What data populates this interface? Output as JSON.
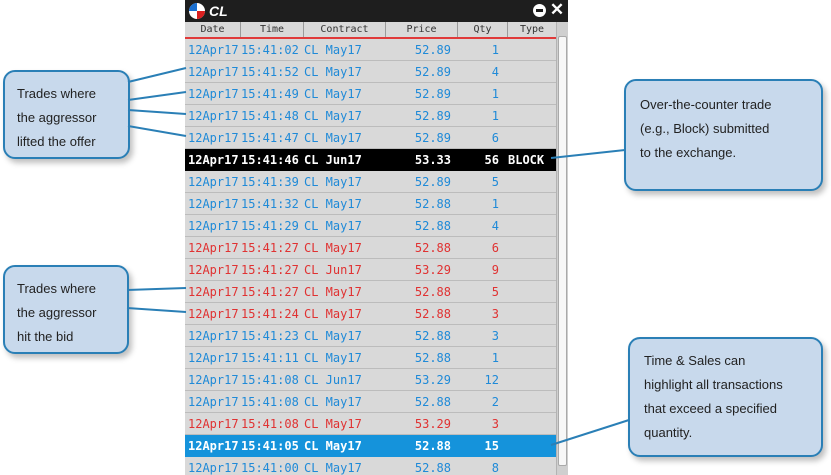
{
  "window": {
    "title": "CL",
    "columns": [
      "Date",
      "Time",
      "Contract",
      "Price",
      "Qty",
      "Type"
    ]
  },
  "trades": [
    {
      "date": "12Apr17",
      "time": "15:41:02",
      "contract": "CL May17",
      "price": "52.89",
      "qty": "1",
      "type": "",
      "side": "buy"
    },
    {
      "date": "12Apr17",
      "time": "15:41:52",
      "contract": "CL May17",
      "price": "52.89",
      "qty": "4",
      "type": "",
      "side": "buy"
    },
    {
      "date": "12Apr17",
      "time": "15:41:49",
      "contract": "CL May17",
      "price": "52.89",
      "qty": "1",
      "type": "",
      "side": "buy"
    },
    {
      "date": "12Apr17",
      "time": "15:41:48",
      "contract": "CL May17",
      "price": "52.89",
      "qty": "1",
      "type": "",
      "side": "buy"
    },
    {
      "date": "12Apr17",
      "time": "15:41:47",
      "contract": "CL May17",
      "price": "52.89",
      "qty": "6",
      "type": "",
      "side": "buy"
    },
    {
      "date": "12Apr17",
      "time": "15:41:46",
      "contract": "CL Jun17",
      "price": "53.33",
      "qty": "56",
      "type": "BLOCK",
      "side": "block"
    },
    {
      "date": "12Apr17",
      "time": "15:41:39",
      "contract": "CL May17",
      "price": "52.89",
      "qty": "5",
      "type": "",
      "side": "buy"
    },
    {
      "date": "12Apr17",
      "time": "15:41:32",
      "contract": "CL May17",
      "price": "52.88",
      "qty": "1",
      "type": "",
      "side": "buy"
    },
    {
      "date": "12Apr17",
      "time": "15:41:29",
      "contract": "CL May17",
      "price": "52.88",
      "qty": "4",
      "type": "",
      "side": "buy"
    },
    {
      "date": "12Apr17",
      "time": "15:41:27",
      "contract": "CL May17",
      "price": "52.88",
      "qty": "6",
      "type": "",
      "side": "sell"
    },
    {
      "date": "12Apr17",
      "time": "15:41:27",
      "contract": "CL Jun17",
      "price": "53.29",
      "qty": "9",
      "type": "",
      "side": "sell"
    },
    {
      "date": "12Apr17",
      "time": "15:41:27",
      "contract": "CL May17",
      "price": "52.88",
      "qty": "5",
      "type": "",
      "side": "sell"
    },
    {
      "date": "12Apr17",
      "time": "15:41:24",
      "contract": "CL May17",
      "price": "52.88",
      "qty": "3",
      "type": "",
      "side": "sell"
    },
    {
      "date": "12Apr17",
      "time": "15:41:23",
      "contract": "CL May17",
      "price": "52.88",
      "qty": "3",
      "type": "",
      "side": "buy"
    },
    {
      "date": "12Apr17",
      "time": "15:41:11",
      "contract": "CL May17",
      "price": "52.88",
      "qty": "1",
      "type": "",
      "side": "buy"
    },
    {
      "date": "12Apr17",
      "time": "15:41:08",
      "contract": "CL Jun17",
      "price": "53.29",
      "qty": "12",
      "type": "",
      "side": "buy"
    },
    {
      "date": "12Apr17",
      "time": "15:41:08",
      "contract": "CL May17",
      "price": "52.88",
      "qty": "2",
      "type": "",
      "side": "buy"
    },
    {
      "date": "12Apr17",
      "time": "15:41:08",
      "contract": "CL May17",
      "price": "53.29",
      "qty": "3",
      "type": "",
      "side": "sell"
    },
    {
      "date": "12Apr17",
      "time": "15:41:05",
      "contract": "CL May17",
      "price": "52.88",
      "qty": "15",
      "type": "",
      "side": "highlight"
    },
    {
      "date": "12Apr17",
      "time": "15:41:00",
      "contract": "CL May17",
      "price": "52.88",
      "qty": "8",
      "type": "",
      "side": "buy"
    }
  ],
  "callouts": {
    "aggressor_offer": [
      "Trades where",
      "the aggressor",
      "lifted the offer"
    ],
    "aggressor_bid": [
      "Trades where",
      "the aggressor",
      "hit the bid"
    ],
    "otc": [
      "Over-the-counter trade",
      "(e.g., Block) submitted",
      "to the exchange."
    ],
    "highlight": [
      "Time & Sales can",
      "highlight all transactions",
      "that exceed a specified",
      "quantity."
    ]
  },
  "colors": {
    "buy_text": "#1f8ad8",
    "sell_text": "#e03232",
    "block_row": "#000000",
    "highlight_row": "#1593db",
    "callout_fill": "#c8d9ec",
    "callout_border": "#2a7fb6"
  },
  "icons": {
    "app_logo": "app-logo-icon",
    "minimize": "minimize-icon",
    "close": "close-icon"
  }
}
